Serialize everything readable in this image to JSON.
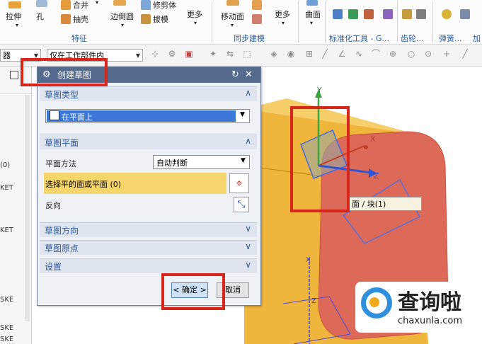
{
  "ribbon": {
    "buttons": {
      "extrude": "拉伸",
      "hole": "孔",
      "unite": "合并",
      "shell": "抽壳",
      "edge_blend": "边倒圆",
      "trim_body": "修剪体",
      "draft": "拔模",
      "more1": "更多",
      "move_face": "移动面",
      "more2": "更多",
      "surface": "曲面",
      "more3": "更多"
    },
    "groups": {
      "feature": "特征",
      "sync": "同步建模",
      "std_parts": "标准化工具 - G...",
      "gear": "齿轮...",
      "spring": "弹簧...",
      "add": "加"
    }
  },
  "toolbar": {
    "filter_left": "器",
    "scope": "仅在工作部件内"
  },
  "left_panel": {
    "items": [
      "(0)",
      "KET",
      "KET",
      "SKE",
      "SKE",
      "SKE"
    ]
  },
  "dialog": {
    "title": "创建草图",
    "sections": {
      "type": "草图类型",
      "plane": "草图平面",
      "orientation": "草图方向",
      "origin": "草图原点",
      "settings": "设置"
    },
    "type_value": "在平面上",
    "plane_method_label": "平面方法",
    "plane_method_value": "自动判断",
    "select_label": "选择平的面或平面 (0)",
    "reverse_label": "反向",
    "ok": "< 确定 >",
    "cancel": "取消"
  },
  "viewport": {
    "axis_y": "Y",
    "axis_x": "X",
    "axis_z": "Z",
    "axis_x2": "X",
    "axis_z2": "Z",
    "tooltip": "面 / 块(1)"
  },
  "watermark": {
    "name": "查询啦",
    "url": "chaxunla.com"
  },
  "colors": {
    "dialog_title": "#546b8e",
    "section_text": "#2f5796",
    "highlight_row": "#f6d56d",
    "block_body": "#f0b63c",
    "red_face": "#dd6a58",
    "annotation": "#d9261c"
  }
}
